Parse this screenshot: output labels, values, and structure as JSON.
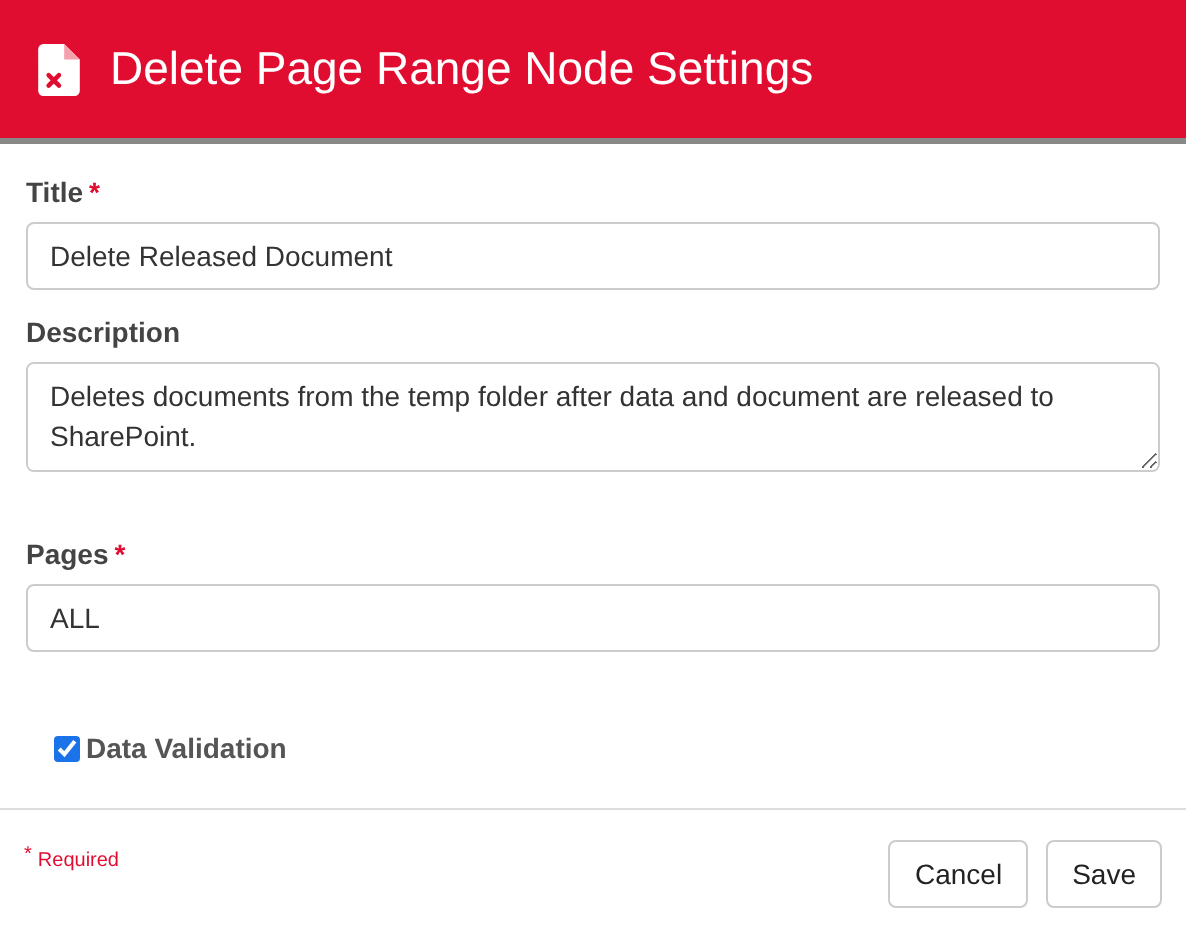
{
  "header": {
    "title": "Delete Page Range Node Settings"
  },
  "fields": [
    {
      "kind": "input",
      "label": "Title",
      "required_mark": "*",
      "value": "Delete Released Document"
    },
    {
      "kind": "textarea",
      "label": "Description",
      "value": "Deletes documents from the temp folder after data and document are released to SharePoint."
    },
    {
      "kind": "input",
      "label": "Pages",
      "required_mark": "*",
      "value": "ALL"
    }
  ],
  "checkbox": {
    "label": "Data Validation",
    "checked": true
  },
  "footer": {
    "note_mark": "*",
    "note": "Required",
    "buttons": [
      "Cancel",
      "Save"
    ]
  }
}
